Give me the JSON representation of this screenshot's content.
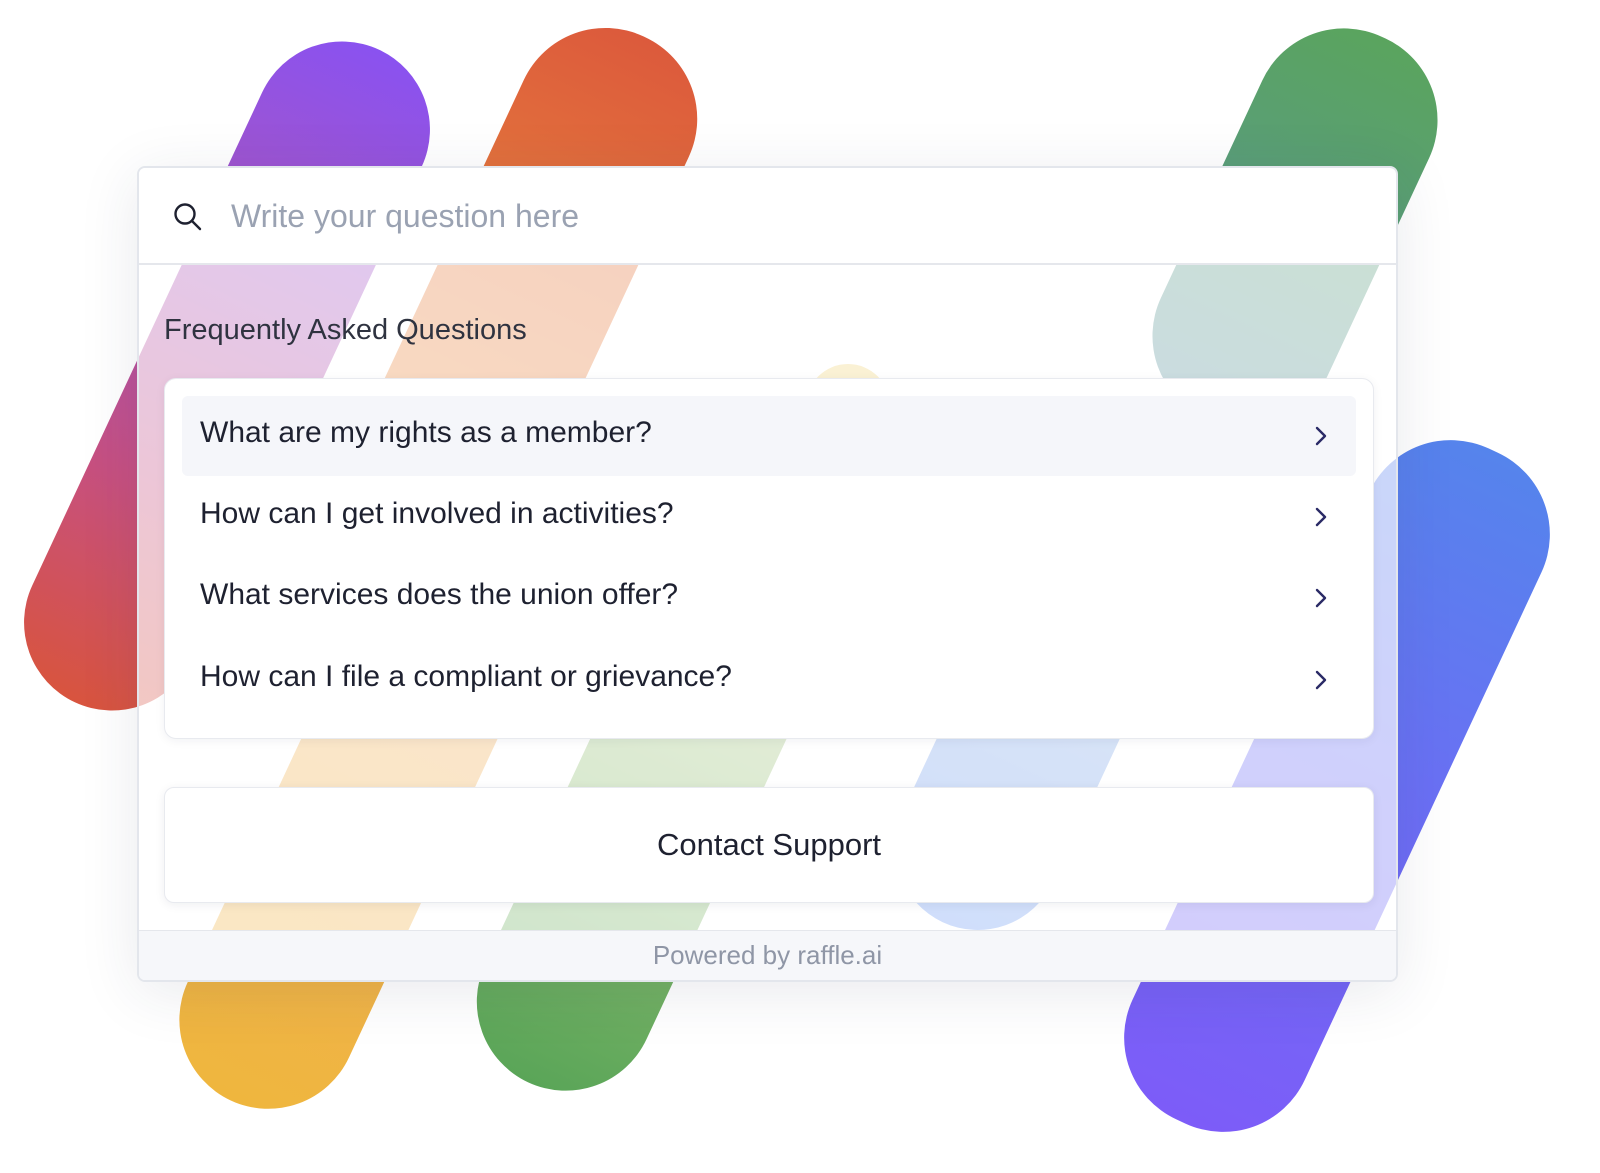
{
  "search": {
    "placeholder": "Write your question here",
    "icon": "search-icon"
  },
  "faq": {
    "heading": "Frequently Asked Questions",
    "items": [
      {
        "question": "What are my rights as a member?",
        "icon": "chevron-right-icon"
      },
      {
        "question": "How can I get involved in activities?",
        "icon": "chevron-right-icon"
      },
      {
        "question": "What services does the union offer?",
        "icon": "chevron-right-icon"
      },
      {
        "question": "How can I file a compliant or grievance?",
        "icon": "chevron-right-icon"
      }
    ]
  },
  "contact": {
    "label": "Contact Support"
  },
  "footer": {
    "text": "Powered by raffle.ai"
  },
  "colors": {
    "text": "#1e2130",
    "placeholder": "#9aa2b2",
    "chevron": "#2a2a66",
    "footer_text": "#8f96a6",
    "highlight_row": "#f5f6fa"
  }
}
